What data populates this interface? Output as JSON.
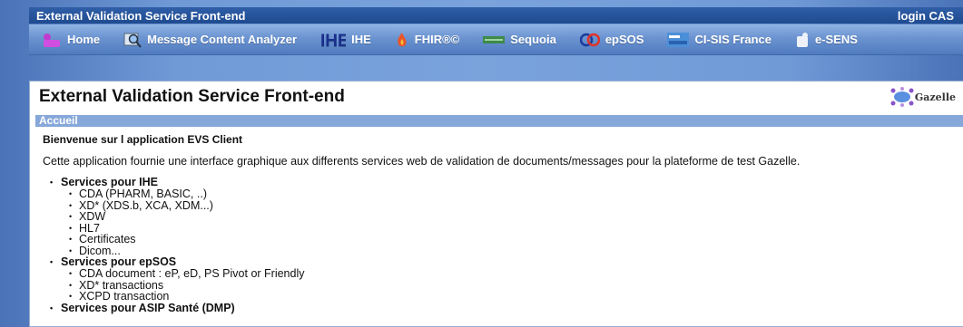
{
  "topbar": {
    "title": "External Validation Service Front-end",
    "login": "login CAS"
  },
  "nav": [
    {
      "label": "Home",
      "icon": "home-icon"
    },
    {
      "label": "Message Content Analyzer",
      "icon": "magnifier-icon"
    },
    {
      "label": "IHE",
      "icon": "ihe-logo-icon"
    },
    {
      "label": "FHIR®©",
      "icon": "flame-icon"
    },
    {
      "label": "Sequoia",
      "icon": "sequoia-logo-icon"
    },
    {
      "label": "epSOS",
      "icon": "epsos-logo-icon"
    },
    {
      "label": "CI-SIS France",
      "icon": "asip-logo-icon"
    },
    {
      "label": "e-SENS",
      "icon": "esens-logo-icon"
    }
  ],
  "panel": {
    "title": "External Validation Service Front-end",
    "logo_text": "Gazelle",
    "section": "Accueil",
    "welcome": "Bienvenue sur l application EVS Client",
    "description": "Cette application fournie une interface graphique aux differents services web de validation de documents/messages pour la plateforme de test Gazelle.",
    "groups": [
      {
        "title": "Services pour IHE",
        "items": [
          "CDA  (PHARM, BASIC, ..)",
          "XD* (XDS.b, XCA, XDM...)",
          "XDW",
          "HL7",
          "Certificates",
          "Dicom..."
        ]
      },
      {
        "title": "Services pour epSOS",
        "items": [
          "CDA document : eP, eD, PS Pivot or Friendly",
          "XD* transactions",
          "XCPD transaction"
        ]
      },
      {
        "title": "Services pour ASIP Santé (DMP)",
        "items": []
      }
    ]
  },
  "colors": {
    "topbar": "#1f4a8f",
    "navbar": "#6b93d0",
    "subbar": "#86a7d9",
    "background": "#6f9ad6"
  }
}
